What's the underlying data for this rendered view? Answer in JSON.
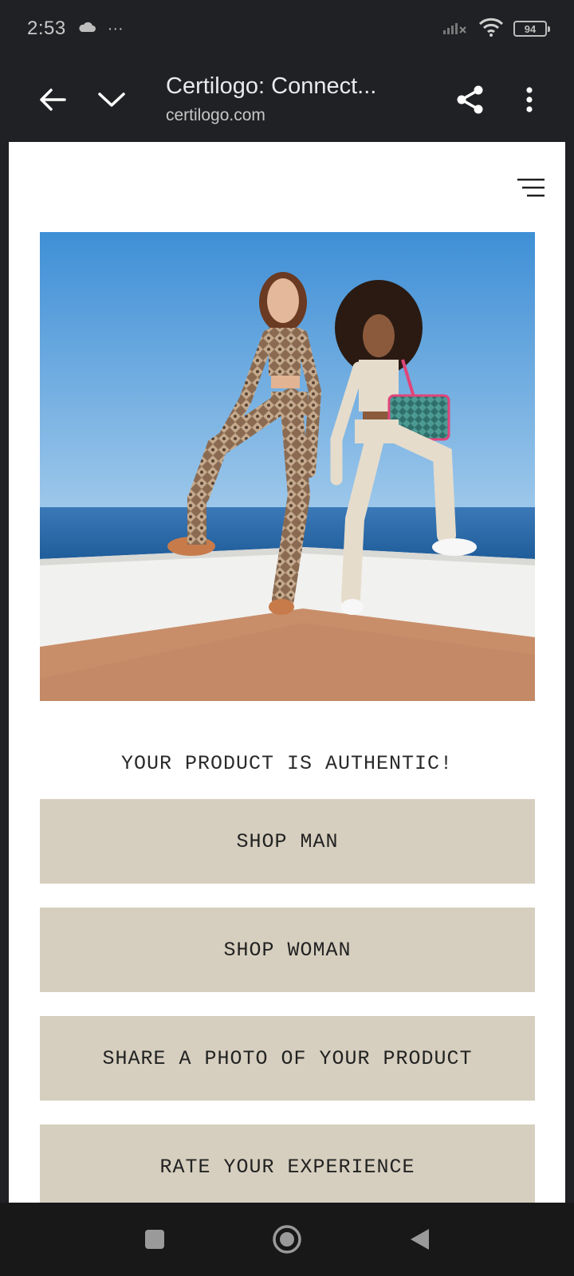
{
  "status_bar": {
    "time": "2:53",
    "more": "···",
    "battery": "94",
    "icons": [
      "cloud-icon",
      "signal-icon",
      "wifi-icon",
      "battery-icon"
    ]
  },
  "toolbar": {
    "title": "Certilogo: Connect...",
    "url": "certilogo.com",
    "icons": [
      "back-arrow-icon",
      "chevron-down-icon",
      "share-icon",
      "more-vert-icon"
    ]
  },
  "page": {
    "menu_icon": "hamburger-menu-icon",
    "hero_image": "two-models-seaside-terrace",
    "authentic_text": "YOUR PRODUCT IS AUTHENTIC!",
    "buttons": [
      {
        "label": "SHOP MAN"
      },
      {
        "label": "SHOP WOMAN"
      },
      {
        "label": "SHARE A PHOTO OF YOUR PRODUCT"
      },
      {
        "label": "RATE YOUR EXPERIENCE"
      }
    ],
    "colors": {
      "button_bg": "#d6cfbf",
      "page_bg": "#ffffff",
      "chrome_bg": "#202124"
    }
  },
  "navbar": {
    "icons": [
      "recents-square-icon",
      "home-circle-icon",
      "back-triangle-icon"
    ]
  }
}
